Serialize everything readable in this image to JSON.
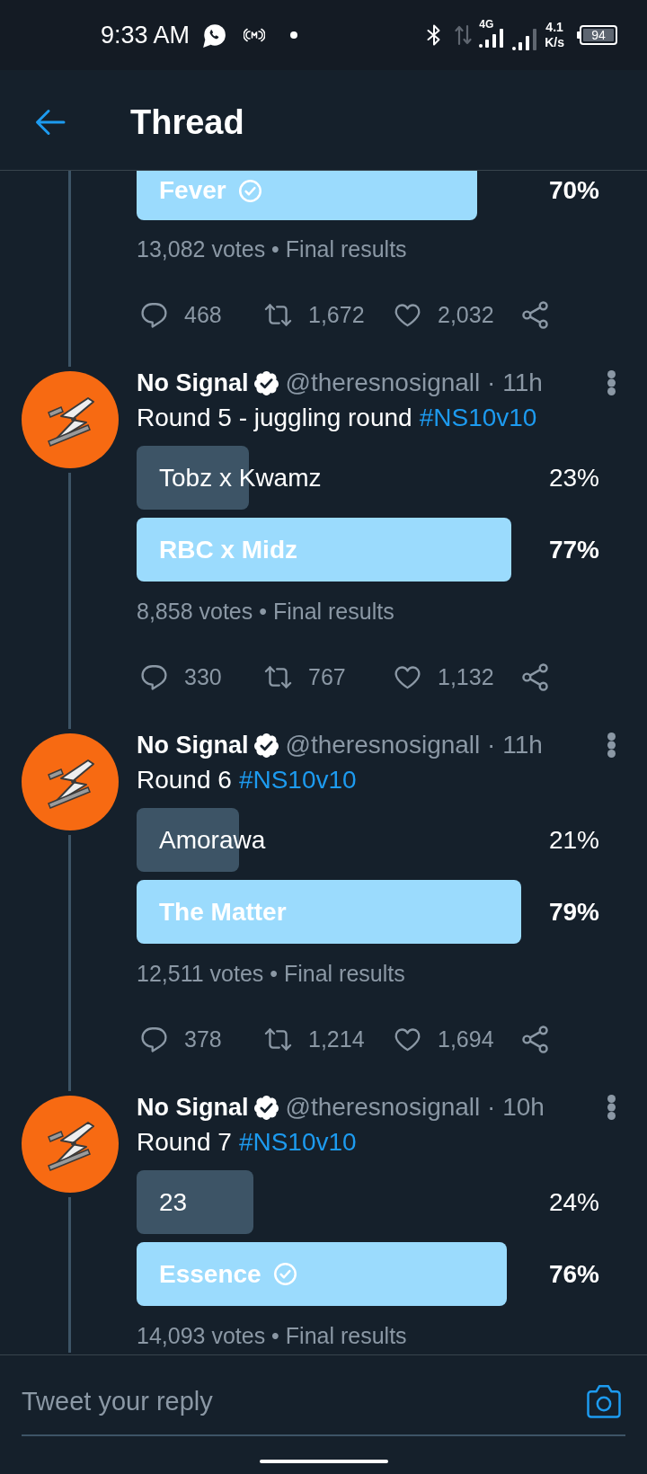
{
  "status_bar": {
    "time": "9:33 AM",
    "network_type": "4G",
    "speed_value": "4.1",
    "speed_unit": "K/s",
    "battery": "94"
  },
  "header": {
    "title": "Thread"
  },
  "partial_tweet": {
    "poll": {
      "options": [
        {
          "label": "Fever",
          "percent": "70%",
          "level": 0.7,
          "winner": true,
          "selected": true
        }
      ],
      "summary": "13,082 votes • Final results"
    },
    "actions": {
      "replies": "468",
      "retweets": "1,672",
      "likes": "2,032"
    }
  },
  "tweets": [
    {
      "name": "No Signal",
      "verified": true,
      "handle_time": "@theresnosignall · 11h",
      "text": "Round 5 - juggling round",
      "hashtag": "#NS10v10",
      "poll": {
        "options": [
          {
            "label": "Tobz x Kwamz",
            "percent": "23%",
            "level": 0.23,
            "winner": false,
            "selected": false
          },
          {
            "label": "RBC x Midz",
            "percent": "77%",
            "level": 0.77,
            "winner": true,
            "selected": false
          }
        ],
        "summary": "8,858 votes • Final results"
      },
      "actions": {
        "replies": "330",
        "retweets": "767",
        "likes": "1,132"
      }
    },
    {
      "name": "No Signal",
      "verified": true,
      "handle_time": "@theresnosignall · 11h",
      "text": "Round 6",
      "hashtag": "#NS10v10",
      "poll": {
        "options": [
          {
            "label": "Amorawa",
            "percent": "21%",
            "level": 0.21,
            "winner": false,
            "selected": false
          },
          {
            "label": "The Matter",
            "percent": "79%",
            "level": 0.79,
            "winner": true,
            "selected": false
          }
        ],
        "summary": "12,511 votes • Final results"
      },
      "actions": {
        "replies": "378",
        "retweets": "1,214",
        "likes": "1,694"
      }
    },
    {
      "name": "No Signal",
      "verified": true,
      "handle_time": "@theresnosignall · 10h",
      "text": "Round 7",
      "hashtag": "#NS10v10",
      "poll": {
        "options": [
          {
            "label": "23",
            "percent": "24%",
            "level": 0.24,
            "winner": false,
            "selected": false
          },
          {
            "label": "Essence",
            "percent": "76%",
            "level": 0.76,
            "winner": true,
            "selected": true
          }
        ],
        "summary": "14,093 votes • Final results"
      }
    }
  ],
  "reply_bar": {
    "placeholder": "Tweet your reply"
  }
}
